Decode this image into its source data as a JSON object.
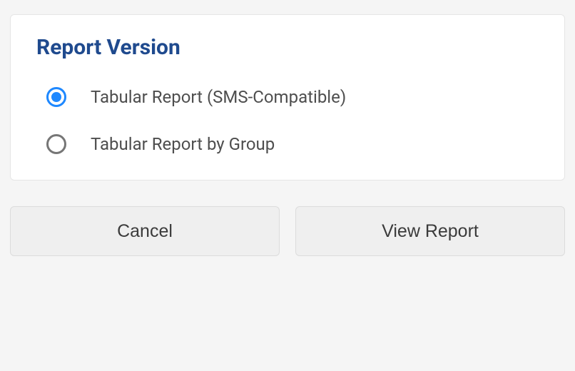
{
  "panel": {
    "title": "Report Version",
    "options": [
      {
        "label": "Tabular Report (SMS-Compatible)",
        "selected": true
      },
      {
        "label": "Tabular Report by Group",
        "selected": false
      }
    ]
  },
  "buttons": {
    "cancel": "Cancel",
    "view": "View Report"
  }
}
